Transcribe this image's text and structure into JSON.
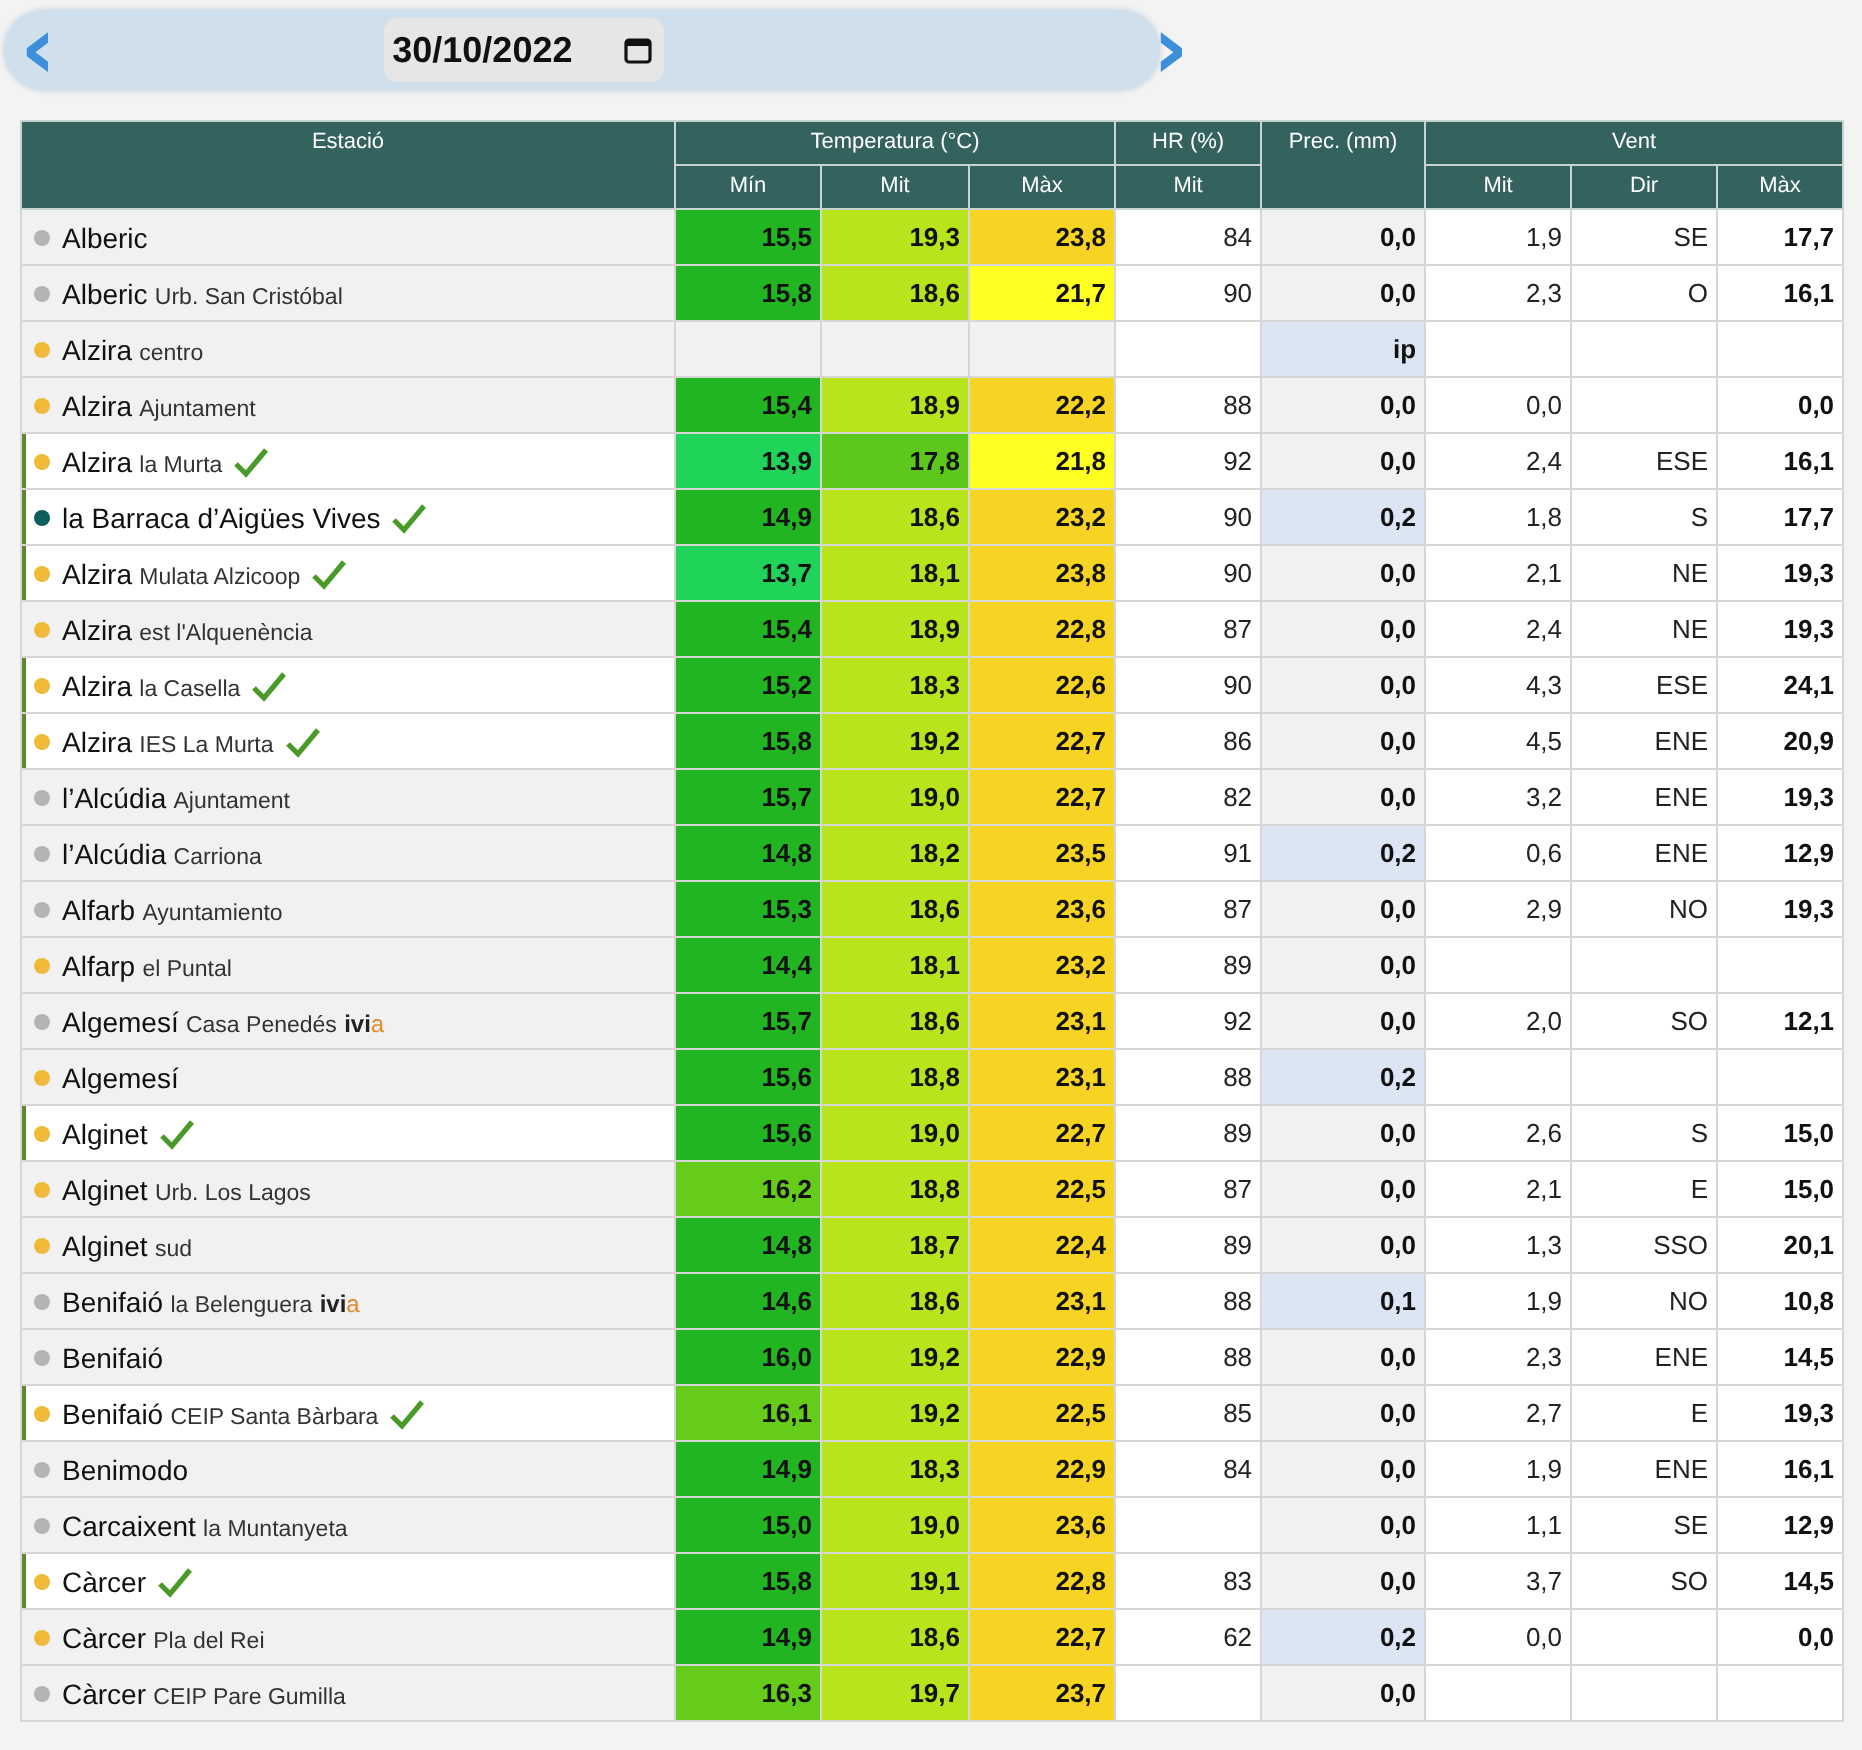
{
  "date_nav": {
    "prev": "‹",
    "date": "30/10/2022",
    "next": "›"
  },
  "table": {
    "groups": [
      "Estació",
      "Temperatura (°C)",
      "HR (%)",
      "Prec. (mm)",
      "Vent"
    ],
    "subheaders": [
      "Mín",
      "Mit",
      "Màx",
      "Mit",
      "Mit",
      "Dir",
      "Màx"
    ],
    "rows": [
      {
        "station": "Alberic",
        "color": "#b4b4b4",
        "verified": false,
        "temps": [
          {
            "value": "15,5",
            "color": "#22b522"
          },
          {
            "value": "19,3",
            "color": "#b8e41c"
          },
          {
            "value": "23,8",
            "color": "#f7d323"
          }
        ],
        "hr": "84",
        "prec": {
          "value": "0,0",
          "highlighted": false
        },
        "wind": [
          "1,9",
          "SE",
          "17,7"
        ]
      },
      {
        "station": "Alberic",
        "place": "Urb. San Cristóbal",
        "color": "#b4b4b4",
        "verified": false,
        "temps": [
          {
            "value": "15,8",
            "color": "#22b522"
          },
          {
            "value": "18,6",
            "color": "#b8e41c"
          },
          {
            "value": "21,7",
            "color": "#ffff22"
          }
        ],
        "hr": "90",
        "prec": {
          "value": "0,0",
          "highlighted": false
        },
        "wind": [
          "2,3",
          "O",
          "16,1"
        ]
      },
      {
        "station": "Alzira",
        "place": "centro",
        "color": "#f0b93a",
        "verified": false,
        "prec": {
          "value": "ip",
          "highlighted": true
        }
      },
      {
        "station": "Alzira",
        "place": "Ajuntament",
        "color": "#f0b93a",
        "verified": false,
        "temps": [
          {
            "value": "15,4",
            "color": "#22b522"
          },
          {
            "value": "18,9",
            "color": "#b8e41c"
          },
          {
            "value": "22,2",
            "color": "#f7d323"
          }
        ],
        "hr": "88",
        "prec": {
          "value": "0,0",
          "highlighted": false
        },
        "wind": {
          "mit": "0,0",
          "max": "0,0"
        }
      },
      {
        "station": "Alzira",
        "place": "la Murta",
        "color": "#f0b93a",
        "verified": true,
        "temps": [
          {
            "value": "13,9",
            "color": "#20d45a"
          },
          {
            "value": "17,8",
            "color": "#5cc81c"
          },
          {
            "value": "21,8",
            "color": "#ffff22"
          }
        ],
        "hr": "92",
        "prec": {
          "value": "0,0",
          "highlighted": false
        },
        "wind": [
          "2,4",
          "ESE",
          "16,1"
        ]
      },
      {
        "station": "la Barraca d’Aigües Vives",
        "color": "#0e5e5e",
        "verified": true,
        "temps": [
          {
            "value": "14,9",
            "color": "#22b522"
          },
          {
            "value": "18,6",
            "color": "#b8e41c"
          },
          {
            "value": "23,2",
            "color": "#f7d323"
          }
        ],
        "hr": "90",
        "prec": {
          "value": "0,2",
          "highlighted": true
        },
        "wind": [
          "1,8",
          "S",
          "17,7"
        ]
      },
      {
        "station": "Alzira",
        "place": "Mulata Alzicoop",
        "color": "#f0b93a",
        "verified": true,
        "temps": [
          {
            "value": "13,7",
            "color": "#20d45a"
          },
          {
            "value": "18,1",
            "color": "#b8e41c"
          },
          {
            "value": "23,8",
            "color": "#f7d323"
          }
        ],
        "hr": "90",
        "prec": {
          "value": "0,0",
          "highlighted": false
        },
        "wind": [
          "2,1",
          "NE",
          "19,3"
        ]
      },
      {
        "station": "Alzira",
        "place": "est l'Alquenència",
        "color": "#f0b93a",
        "verified": false,
        "temps": [
          {
            "value": "15,4",
            "color": "#22b522"
          },
          {
            "value": "18,9",
            "color": "#b8e41c"
          },
          {
            "value": "22,8",
            "color": "#f7d323"
          }
        ],
        "hr": "87",
        "prec": {
          "value": "0,0",
          "highlighted": false
        },
        "wind": [
          "2,4",
          "NE",
          "19,3"
        ]
      },
      {
        "station": "Alzira",
        "place": "la Casella",
        "color": "#f0b93a",
        "verified": true,
        "temps": [
          {
            "value": "15,2",
            "color": "#22b522"
          },
          {
            "value": "18,3",
            "color": "#b8e41c"
          },
          {
            "value": "22,6",
            "color": "#f7d323"
          }
        ],
        "hr": "90",
        "prec": {
          "value": "0,0",
          "highlighted": false
        },
        "wind": [
          "4,3",
          "ESE",
          "24,1"
        ]
      },
      {
        "station": "Alzira",
        "place": "IES La Murta",
        "color": "#f0b93a",
        "verified": true,
        "temps": [
          {
            "value": "15,8",
            "color": "#22b522"
          },
          {
            "value": "19,2",
            "color": "#b8e41c"
          },
          {
            "value": "22,7",
            "color": "#f7d323"
          }
        ],
        "hr": "86",
        "prec": {
          "value": "0,0",
          "highlighted": false
        },
        "wind": [
          "4,5",
          "ENE",
          "20,9"
        ]
      },
      {
        "station": "l’Alcúdia",
        "place": "Ajuntament",
        "color": "#b4b4b4",
        "verified": false,
        "temps": [
          {
            "value": "15,7",
            "color": "#22b522"
          },
          {
            "value": "19,0",
            "color": "#b8e41c"
          },
          {
            "value": "22,7",
            "color": "#f7d323"
          }
        ],
        "hr": "82",
        "prec": {
          "value": "0,0",
          "highlighted": false
        },
        "wind": [
          "3,2",
          "ENE",
          "19,3"
        ]
      },
      {
        "station": "l’Alcúdia",
        "place": "Carriona",
        "color": "#b4b4b4",
        "verified": false,
        "temps": [
          {
            "value": "14,8",
            "color": "#22b522"
          },
          {
            "value": "18,2",
            "color": "#b8e41c"
          },
          {
            "value": "23,5",
            "color": "#f7d323"
          }
        ],
        "hr": "91",
        "prec": {
          "value": "0,2",
          "highlighted": true
        },
        "wind": [
          "0,6",
          "ENE",
          "12,9"
        ]
      },
      {
        "station": "Alfarb",
        "place": "Ayuntamiento",
        "color": "#b4b4b4",
        "verified": false,
        "temps": [
          {
            "value": "15,3",
            "color": "#22b522"
          },
          {
            "value": "18,6",
            "color": "#b8e41c"
          },
          {
            "value": "23,6",
            "color": "#f7d323"
          }
        ],
        "hr": "87",
        "prec": {
          "value": "0,0",
          "highlighted": false
        },
        "wind": [
          "2,9",
          "NO",
          "19,3"
        ]
      },
      {
        "station": "Alfarp",
        "place": "el Puntal",
        "color": "#f0b93a",
        "verified": false,
        "temps": [
          {
            "value": "14,4",
            "color": "#22b522"
          },
          {
            "value": "18,1",
            "color": "#b8e41c"
          },
          {
            "value": "23,2",
            "color": "#f7d323"
          }
        ],
        "hr": "89",
        "prec": {
          "value": "0,0",
          "highlighted": false
        }
      },
      {
        "station": "Algemesí",
        "place": "Casa Penedés",
        "tag": "ivi",
        "tag_accent": "a",
        "color": "#b4b4b4",
        "verified": false,
        "temps": [
          {
            "value": "15,7",
            "color": "#22b522"
          },
          {
            "value": "18,6",
            "color": "#b8e41c"
          },
          {
            "value": "23,1",
            "color": "#f7d323"
          }
        ],
        "hr": "92",
        "prec": {
          "value": "0,0",
          "highlighted": false
        },
        "wind": [
          "2,0",
          "SO",
          "12,1"
        ]
      },
      {
        "station": "Algemesí",
        "color": "#f0b93a",
        "verified": false,
        "temps": [
          {
            "value": "15,6",
            "color": "#22b522"
          },
          {
            "value": "18,8",
            "color": "#b8e41c"
          },
          {
            "value": "23,1",
            "color": "#f7d323"
          }
        ],
        "hr": "88",
        "prec": {
          "value": "0,2",
          "highlighted": true
        }
      },
      {
        "station": "Alginet",
        "color": "#f0b93a",
        "verified": true,
        "temps": [
          {
            "value": "15,6",
            "color": "#22b522"
          },
          {
            "value": "19,0",
            "color": "#b8e41c"
          },
          {
            "value": "22,7",
            "color": "#f7d323"
          }
        ],
        "hr": "89",
        "prec": {
          "value": "0,0",
          "highlighted": false
        },
        "wind": [
          "2,6",
          "S",
          "15,0"
        ]
      },
      {
        "station": "Alginet",
        "place": "Urb. Los Lagos",
        "color": "#f0b93a",
        "verified": false,
        "temps": [
          {
            "value": "16,2",
            "color": "#66cc1a"
          },
          {
            "value": "18,8",
            "color": "#b8e41c"
          },
          {
            "value": "22,5",
            "color": "#f7d323"
          }
        ],
        "hr": "87",
        "prec": {
          "value": "0,0",
          "highlighted": false
        },
        "wind": [
          "2,1",
          "E",
          "15,0"
        ]
      },
      {
        "station": "Alginet",
        "place": "sud",
        "color": "#f0b93a",
        "verified": false,
        "temps": [
          {
            "value": "14,8",
            "color": "#22b522"
          },
          {
            "value": "18,7",
            "color": "#b8e41c"
          },
          {
            "value": "22,4",
            "color": "#f7d323"
          }
        ],
        "hr": "89",
        "prec": {
          "value": "0,0",
          "highlighted": false
        },
        "wind": [
          "1,3",
          "SSO",
          "20,1"
        ]
      },
      {
        "station": "Benifaió",
        "place": "la Belenguera",
        "tag": "ivi",
        "tag_accent": "a",
        "color": "#b4b4b4",
        "verified": false,
        "temps": [
          {
            "value": "14,6",
            "color": "#22b522"
          },
          {
            "value": "18,6",
            "color": "#b8e41c"
          },
          {
            "value": "23,1",
            "color": "#f7d323"
          }
        ],
        "hr": "88",
        "prec": {
          "value": "0,1",
          "highlighted": true
        },
        "wind": [
          "1,9",
          "NO",
          "10,8"
        ]
      },
      {
        "station": "Benifaió",
        "color": "#b4b4b4",
        "verified": false,
        "temps": [
          {
            "value": "16,0",
            "color": "#22b522"
          },
          {
            "value": "19,2",
            "color": "#b8e41c"
          },
          {
            "value": "22,9",
            "color": "#f7d323"
          }
        ],
        "hr": "88",
        "prec": {
          "value": "0,0",
          "highlighted": false
        },
        "wind": [
          "2,3",
          "ENE",
          "14,5"
        ]
      },
      {
        "station": "Benifaió",
        "place": "CEIP Santa Bàrbara",
        "color": "#f0b93a",
        "verified": true,
        "temps": [
          {
            "value": "16,1",
            "color": "#66cc1a"
          },
          {
            "value": "19,2",
            "color": "#b8e41c"
          },
          {
            "value": "22,5",
            "color": "#f7d323"
          }
        ],
        "hr": "85",
        "prec": {
          "value": "0,0",
          "highlighted": false
        },
        "wind": [
          "2,7",
          "E",
          "19,3"
        ]
      },
      {
        "station": "Benimodo",
        "color": "#b4b4b4",
        "verified": false,
        "temps": [
          {
            "value": "14,9",
            "color": "#22b522"
          },
          {
            "value": "18,3",
            "color": "#b8e41c"
          },
          {
            "value": "22,9",
            "color": "#f7d323"
          }
        ],
        "hr": "84",
        "prec": {
          "value": "0,0",
          "highlighted": false
        },
        "wind": [
          "1,9",
          "ENE",
          "16,1"
        ]
      },
      {
        "station": "Carcaixent",
        "place": "la Muntanyeta",
        "color": "#b4b4b4",
        "verified": false,
        "temps": [
          {
            "value": "15,0",
            "color": "#22b522"
          },
          {
            "value": "19,0",
            "color": "#b8e41c"
          },
          {
            "value": "23,6",
            "color": "#f7d323"
          }
        ],
        "prec": {
          "value": "0,0",
          "highlighted": false
        },
        "wind": [
          "1,1",
          "SE",
          "12,9"
        ]
      },
      {
        "station": "Càrcer",
        "color": "#f0b93a",
        "verified": true,
        "temps": [
          {
            "value": "15,8",
            "color": "#22b522"
          },
          {
            "value": "19,1",
            "color": "#b8e41c"
          },
          {
            "value": "22,8",
            "color": "#f7d323"
          }
        ],
        "hr": "83",
        "prec": {
          "value": "0,0",
          "highlighted": false
        },
        "wind": [
          "3,7",
          "SO",
          "14,5"
        ]
      },
      {
        "station": "Càrcer",
        "place": "Pla del Rei",
        "color": "#f0b93a",
        "verified": false,
        "temps": [
          {
            "value": "14,9",
            "color": "#22b522"
          },
          {
            "value": "18,6",
            "color": "#b8e41c"
          },
          {
            "value": "22,7",
            "color": "#f7d323"
          }
        ],
        "hr": "62",
        "prec": {
          "value": "0,2",
          "highlighted": true
        },
        "wind": {
          "mit": "0,0",
          "max": "0,0"
        }
      },
      {
        "station": "Càrcer",
        "place": "CEIP Pare Gumilla",
        "color": "#b4b4b4",
        "verified": false,
        "temps": [
          {
            "value": "16,3",
            "color": "#66cc1a"
          },
          {
            "value": "19,7",
            "color": "#b8e41c"
          },
          {
            "value": "23,7",
            "color": "#f7d323"
          }
        ],
        "prec": {
          "value": "0,0",
          "highlighted": false
        }
      }
    ]
  }
}
